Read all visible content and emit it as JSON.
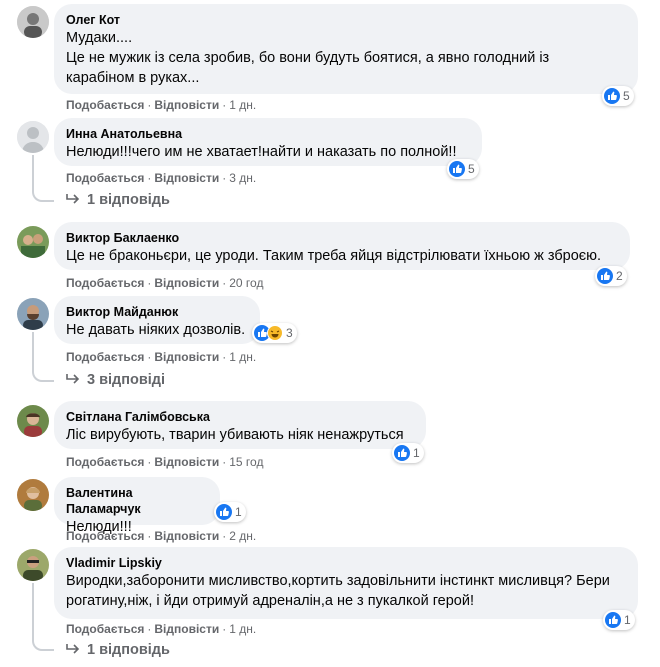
{
  "actions": {
    "like": "Подобається",
    "reply": "Відповісти"
  },
  "comments": [
    {
      "author": "Олег Кот",
      "text": "Мудаки....\nЦе не мужик із села зробив, бо вони будуть боятися, а явно голодний із\nкарабіном в руках...",
      "time": "1 дн.",
      "reactions": "5"
    },
    {
      "author": "Инна Анатольевна",
      "text": "Нелюди!!!чего им не хватает!найти и наказать по полной!!",
      "time": "3 дн.",
      "reactions": "5",
      "replies": "1 відповідь"
    },
    {
      "author": "Виктор Баклаенко",
      "text": "Це не браконьєри, це уроди. Таким треба яйця відстрілювати їхньою ж зброєю.",
      "time": "20 год",
      "reactions": "2"
    },
    {
      "author": "Виктор Майданюк",
      "text": "Не давать ніяких дозволів.",
      "time": "1 дн.",
      "reactions": "3",
      "replies": "3 відповіді"
    },
    {
      "author": "Світлана Галімбовська",
      "text": "Ліс вирубують, тварин убивають ніяк ненажруться",
      "time": "15 год",
      "reactions": "1"
    },
    {
      "author": "Валентина Паламарчук",
      "text": "Нелюди!!!",
      "time": "2 дн.",
      "reactions": "1"
    },
    {
      "author": "Vladimir Lipskiy",
      "text": "Виродки,заборонити мисливство,кортить задовільнити інстинкт мисливця? Бери\nрогатину,ніж, і йди отримуй адреналін,а не з пукалкой герой!",
      "time": "1 дн.",
      "reactions": "1",
      "replies": "1 відповідь"
    }
  ],
  "icons": {
    "like": "thumbs-up-icon",
    "haha": "laughing-face-icon",
    "reply_arrow": "reply-arrow-icon"
  },
  "colors": {
    "like_blue": "#1877f2",
    "haha_yellow": "#f7b928",
    "bubble_bg": "#f0f2f5",
    "meta_gray": "#65676b"
  }
}
